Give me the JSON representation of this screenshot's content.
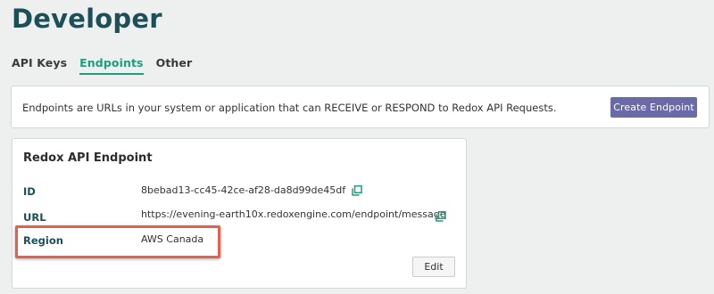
{
  "page": {
    "title": "Developer"
  },
  "tabs": [
    {
      "label": "API Keys",
      "active": false
    },
    {
      "label": "Endpoints",
      "active": true
    },
    {
      "label": "Other",
      "active": false
    }
  ],
  "info": {
    "text": "Endpoints are URLs in your system or application that can RECEIVE or RESPOND to Redox API Requests.",
    "create_button": "Create Endpoint"
  },
  "card": {
    "title": "Redox API Endpoint",
    "fields": [
      {
        "label": "ID",
        "value": "8bebad13-cc45-42ce-af28-da8d99de45df",
        "copyable": true
      },
      {
        "label": "URL",
        "value": "https://evening-earth10x.redoxengine.com/endpoint/message",
        "copyable": true
      },
      {
        "label": "Region",
        "value": "AWS Canada",
        "copyable": false
      }
    ],
    "edit_button": "Edit"
  },
  "colors": {
    "title": "#1d4f59",
    "accent": "#1e9e7a",
    "primary_button": "#6a6aa8",
    "highlight": "#e8604d"
  },
  "icons": {
    "copy": "copy-icon"
  }
}
